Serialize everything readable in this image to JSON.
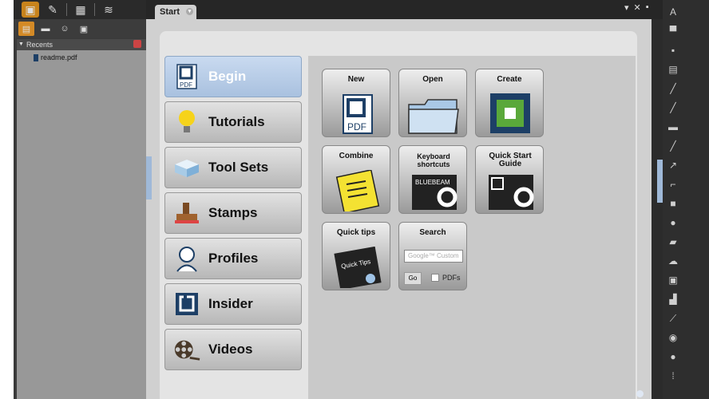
{
  "tabs": {
    "start_label": "Start"
  },
  "left_panel": {
    "recents_label": "Recents",
    "recent_file": "readme.pdf"
  },
  "nav": [
    {
      "label": "Begin",
      "icon": "pdf-icon",
      "active": true
    },
    {
      "label": "Tutorials",
      "icon": "lightbulb-icon"
    },
    {
      "label": "Tool Sets",
      "icon": "toolbox-icon"
    },
    {
      "label": "Stamps",
      "icon": "stamp-icon"
    },
    {
      "label": "Profiles",
      "icon": "profile-icon"
    },
    {
      "label": "Insider",
      "icon": "insider-icon"
    },
    {
      "label": "Videos",
      "icon": "film-reel-icon"
    }
  ],
  "tiles": {
    "new": "New",
    "open": "Open",
    "create": "Create",
    "combine": "Combine",
    "shortcuts": "Keyboard shortcuts",
    "quickstart": "Quick Start Guide",
    "quicktips": "Quick tips",
    "search": "Search",
    "search_placeholder": "Google™ Custom",
    "go": "Go",
    "pdfs": "PDFs"
  },
  "colors": {
    "accent_orange": "#c8831c",
    "active_nav_blue": "#a9c1df",
    "brand_blue": "#1d3f66"
  }
}
